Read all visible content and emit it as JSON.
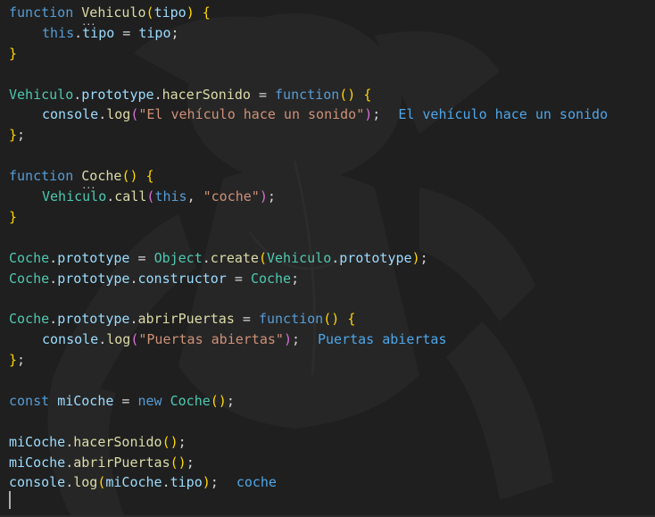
{
  "editor": {
    "background": "#1f1f1f",
    "colors": {
      "keyword": "#569cd6",
      "function": "#dcdcaa",
      "class": "#4ec9b0",
      "variable": "#9cdcfe",
      "string": "#ce9178",
      "inline_result": "#4fa6e8"
    },
    "lines": {
      "l1": {
        "kw": "function",
        "name": "Vehiculo",
        "p1": "(",
        "param": "tipo",
        "p2": ")",
        "sp": " ",
        "brace": "{"
      },
      "l2": {
        "this": "this",
        "dot": ".",
        "prop": "tipo",
        "eq": " = ",
        "val": "tipo",
        "semi": ";"
      },
      "l3": {
        "brace": "}"
      },
      "l5": {
        "obj": "Vehiculo",
        "d1": ".",
        "proto": "prototype",
        "d2": ".",
        "method": "hacerSonido",
        "eq": " = ",
        "kw": "function",
        "paren": "()",
        "sp": " ",
        "brace": "{"
      },
      "l6": {
        "obj": "console",
        "dot": ".",
        "fn": "log",
        "p1": "(",
        "str": "\"El vehículo hace un sonido\"",
        "p2": ")",
        "semi": ";",
        "result": "El vehículo hace un sonido"
      },
      "l7": {
        "brace": "}",
        "semi": ";"
      },
      "l9": {
        "kw": "function",
        "name": "Coche",
        "paren": "()",
        "sp": " ",
        "brace": "{"
      },
      "l10": {
        "cls": "Vehiculo",
        "dot": ".",
        "fn": "call",
        "p1": "(",
        "this": "this",
        "comma": ", ",
        "str": "\"coche\"",
        "p2": ")",
        "semi": ";"
      },
      "l11": {
        "brace": "}"
      },
      "l13": {
        "obj": "Coche",
        "d1": ".",
        "proto": "prototype",
        "eq": " = ",
        "cls": "Object",
        "d2": ".",
        "fn": "create",
        "p1": "(",
        "arg": "Vehiculo",
        "d3": ".",
        "argprop": "prototype",
        "p2": ")",
        "semi": ";"
      },
      "l14": {
        "obj": "Coche",
        "d1": ".",
        "proto": "prototype",
        "d2": ".",
        "prop": "constructor",
        "eq": " = ",
        "cls": "Coche",
        "semi": ";"
      },
      "l16": {
        "obj": "Coche",
        "d1": ".",
        "proto": "prototype",
        "d2": ".",
        "method": "abrirPuertas",
        "eq": " = ",
        "kw": "function",
        "paren": "()",
        "sp": " ",
        "brace": "{"
      },
      "l17": {
        "obj": "console",
        "dot": ".",
        "fn": "log",
        "p1": "(",
        "str": "\"Puertas abiertas\"",
        "p2": ")",
        "semi": ";",
        "result": "Puertas abiertas"
      },
      "l18": {
        "brace": "}",
        "semi": ";"
      },
      "l20": {
        "kw": "const",
        "name": "miCoche",
        "eq": " = ",
        "kw2": "new",
        "cls": "Coche",
        "paren": "()",
        "semi": ";"
      },
      "l22": {
        "obj": "miCoche",
        "dot": ".",
        "fn": "hacerSonido",
        "paren": "()",
        "semi": ";"
      },
      "l23": {
        "obj": "miCoche",
        "dot": ".",
        "fn": "abrirPuertas",
        "paren": "()",
        "semi": ";"
      },
      "l24": {
        "obj": "console",
        "dot": ".",
        "fn": "log",
        "p1": "(",
        "arg": "miCoche",
        "d2": ".",
        "prop": "tipo",
        "p2": ")",
        "semi": ";",
        "result": "coche"
      }
    }
  }
}
